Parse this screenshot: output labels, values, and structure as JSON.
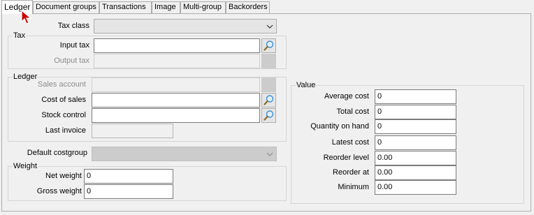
{
  "tabs": [
    {
      "label": "Ledger",
      "active": true
    },
    {
      "label": "Document groups"
    },
    {
      "label": "Transactions"
    },
    {
      "label": "Image"
    },
    {
      "label": "Multi-group"
    },
    {
      "label": "Backorders"
    }
  ],
  "tax_class": {
    "label": "Tax class",
    "value": ""
  },
  "tax": {
    "title": "Tax",
    "input_tax_label": "Input tax",
    "input_tax_value": "",
    "output_tax_label": "Output tax",
    "output_tax_value": ""
  },
  "ledger": {
    "title": "Ledger",
    "sales_account_label": "Sales account",
    "sales_account_value": "",
    "cost_of_sales_label": "Cost of sales",
    "cost_of_sales_value": "",
    "stock_control_label": "Stock control",
    "stock_control_value": "",
    "last_invoice_label": "Last invoice",
    "last_invoice_value": ""
  },
  "default_costgroup": {
    "label": "Default costgroup",
    "value": ""
  },
  "weight": {
    "title": "Weight",
    "net_label": "Net weight",
    "net_value": "0",
    "gross_label": "Gross weight",
    "gross_value": "0"
  },
  "value": {
    "title": "Value",
    "rows": [
      {
        "label": "Average cost",
        "value": "0"
      },
      {
        "label": "Total cost",
        "value": "0"
      },
      {
        "label": "Quantity on hand",
        "value": "0"
      },
      {
        "label": "Latest cost",
        "value": "0"
      },
      {
        "label": "Reorder level",
        "value": "0.00"
      },
      {
        "label": "Reorder at",
        "value": "0.00"
      },
      {
        "label": "Minimum",
        "value": "0.00"
      }
    ]
  },
  "icons": {
    "lookup": "magnifier-icon",
    "dropdown": "chevron-down-icon",
    "cursor": "mouse-pointer-icon"
  },
  "colors": {
    "cursor_red": "#cc0000",
    "lookup_glass": "#3a8fd0"
  }
}
